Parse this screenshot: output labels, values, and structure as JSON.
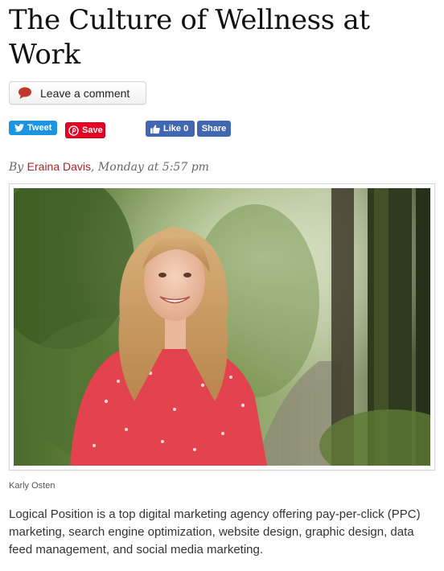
{
  "article": {
    "title": "The Culture of Wellness at Work",
    "comment_button": "Leave a comment",
    "byline": {
      "by": "By",
      "author": "Eraina Davis",
      "date": ", Monday at 5:57 pm"
    },
    "photo_caption": "Karly Osten",
    "body": "Logical Position is a top digital marketing agency offering pay-per-click (PPC) marketing, search engine optimization, website design, graphic design, data feed management, and social media marketing."
  },
  "share": {
    "tweet": "Tweet",
    "save": "Save",
    "like": "Like 0",
    "share": "Share"
  },
  "icons": {
    "comment": "speech-bubble-icon",
    "tweet": "twitter-bird-icon",
    "save": "pinterest-icon",
    "like": "thumbs-up-icon"
  },
  "colors": {
    "twitter": "#1b95e0",
    "pinterest": "#e60023",
    "facebook": "#4267b2",
    "author_link": "#a4262c"
  }
}
